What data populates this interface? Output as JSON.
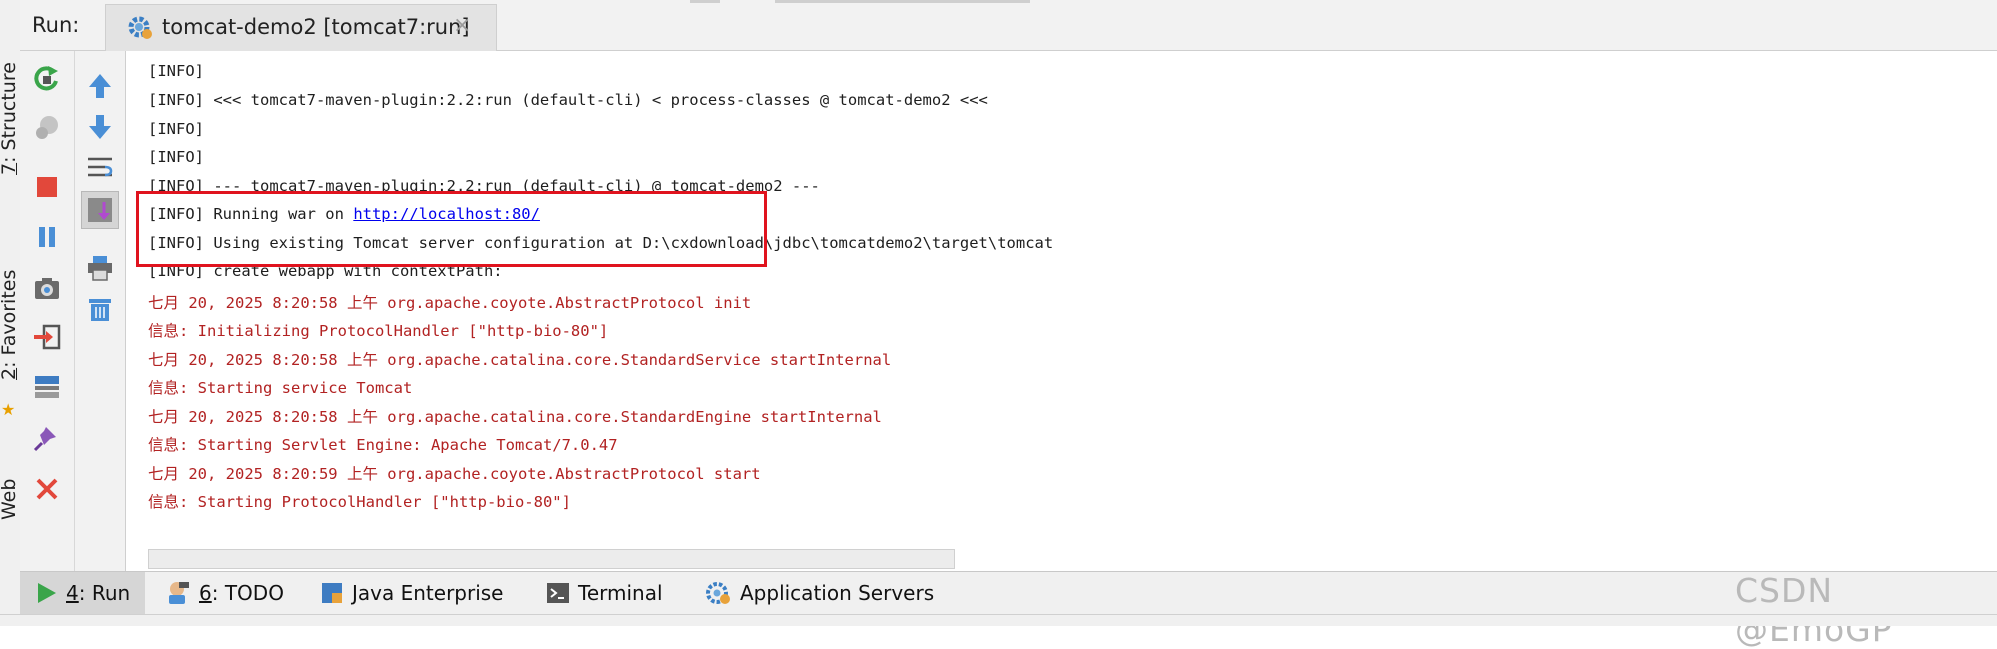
{
  "run_panel": {
    "label": "Run:",
    "tab_title": "tomcat-demo2 [tomcat7:run]",
    "close_symbol": "×"
  },
  "left_tabs": {
    "structure": {
      "num": "7",
      "label": ": Structure"
    },
    "favorites": {
      "num": "2",
      "label": ": Favorites"
    },
    "web": {
      "label": "Web"
    }
  },
  "console": {
    "lines": [
      {
        "text": "[INFO]",
        "color": "normal"
      },
      {
        "text": "[INFO] <<< tomcat7-maven-plugin:2.2:run (default-cli) < process-classes @ tomcat-demo2 <<<",
        "color": "normal"
      },
      {
        "text": "[INFO]",
        "color": "normal"
      },
      {
        "text": "[INFO]",
        "color": "normal"
      },
      {
        "text": "[INFO] --- tomcat7-maven-plugin:2.2:run (default-cli) @ tomcat-demo2 ---",
        "color": "normal"
      },
      {
        "prefix": "[INFO] Running war on ",
        "link": "http://localhost:80/",
        "color": "normal"
      },
      {
        "text": "[INFO] Using existing Tomcat server configuration at D:\\cxdownload\\jdbc\\tomcatdemo2\\target\\tomcat",
        "color": "normal"
      },
      {
        "text": "[INFO] create webapp with contextPath:",
        "color": "normal"
      },
      {
        "text": "七月 20, 2025 8:20:58 上午 org.apache.coyote.AbstractProtocol init",
        "color": "red"
      },
      {
        "text": "信息: Initializing ProtocolHandler [\"http-bio-80\"]",
        "color": "red"
      },
      {
        "text": "七月 20, 2025 8:20:58 上午 org.apache.catalina.core.StandardService startInternal",
        "color": "red"
      },
      {
        "text": "信息: Starting service Tomcat",
        "color": "red"
      },
      {
        "text": "七月 20, 2025 8:20:58 上午 org.apache.catalina.core.StandardEngine startInternal",
        "color": "red"
      },
      {
        "text": "信息: Starting Servlet Engine: Apache Tomcat/7.0.47",
        "color": "red"
      },
      {
        "text": "七月 20, 2025 8:20:59 上午 org.apache.coyote.AbstractProtocol start",
        "color": "red"
      },
      {
        "text": "信息: Starting ProtocolHandler [\"http-bio-80\"]",
        "color": "red"
      }
    ],
    "text_color": "#1e1e1e",
    "stderr_color": "#b22222",
    "link_color": "#0000ee",
    "highlight_color": "#e0131e"
  },
  "bottom_tabs": {
    "run": {
      "num": "4",
      "label": ": Run"
    },
    "todo": {
      "num": "6",
      "label": ": TODO"
    },
    "java_enterprise": {
      "label": "Java Enterprise"
    },
    "terminal": {
      "label": "Terminal"
    },
    "app_servers": {
      "label": "Application Servers"
    }
  },
  "watermark": "CSDN @EmoGP",
  "icons": {
    "toolbar1": [
      "rerun-icon",
      "debug-disabled-icon",
      "stop-icon",
      "pause-icon",
      "camera-icon",
      "restore-layout-icon",
      "layout-icon",
      "pin-icon",
      "close-icon"
    ],
    "toolbar2": [
      "up-arrow-icon",
      "down-arrow-icon",
      "soft-wrap-icon",
      "scroll-to-end-icon",
      "print-icon",
      "trash-icon"
    ]
  }
}
